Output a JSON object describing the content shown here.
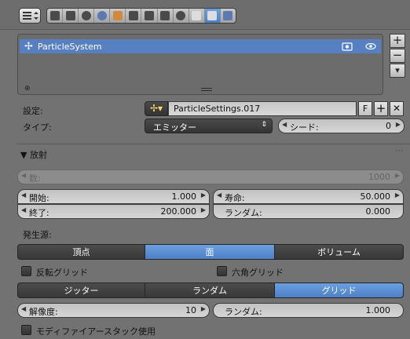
{
  "list": {
    "item_name": "ParticleSystem"
  },
  "settings": {
    "label": "設定:",
    "datablock_name": "ParticleSettings.017",
    "fake_user": "F"
  },
  "type": {
    "label": "タイプ:",
    "value": "エミッター",
    "seed_label": "シード:",
    "seed_value": "0"
  },
  "emission": {
    "header": "▼ 放射",
    "count_label": "数:",
    "count_value": "1000",
    "start_label": "開始:",
    "start_value": "1.000",
    "end_label": "終了:",
    "end_value": "200.000",
    "lifetime_label": "寿命:",
    "lifetime_value": "50.000",
    "random_label": "ランダム:",
    "random_value": "0.000"
  },
  "source": {
    "label": "発生源:",
    "emit_from": [
      "頂点",
      "面",
      "ボリューム"
    ],
    "emit_from_active": 1,
    "invert_grid": "反転グリッド",
    "hex_grid": "六角グリッド",
    "distribution": [
      "ジッター",
      "ランダム",
      "グリッド"
    ],
    "distribution_active": 2,
    "resolution_label": "解像度:",
    "resolution_value": "10",
    "grid_random_label": "ランダム:",
    "grid_random_value": "1.000",
    "modifier_stack": "モディファイアースタック使用"
  },
  "colors": {
    "active": "#5680c2",
    "panel": "#727272"
  }
}
